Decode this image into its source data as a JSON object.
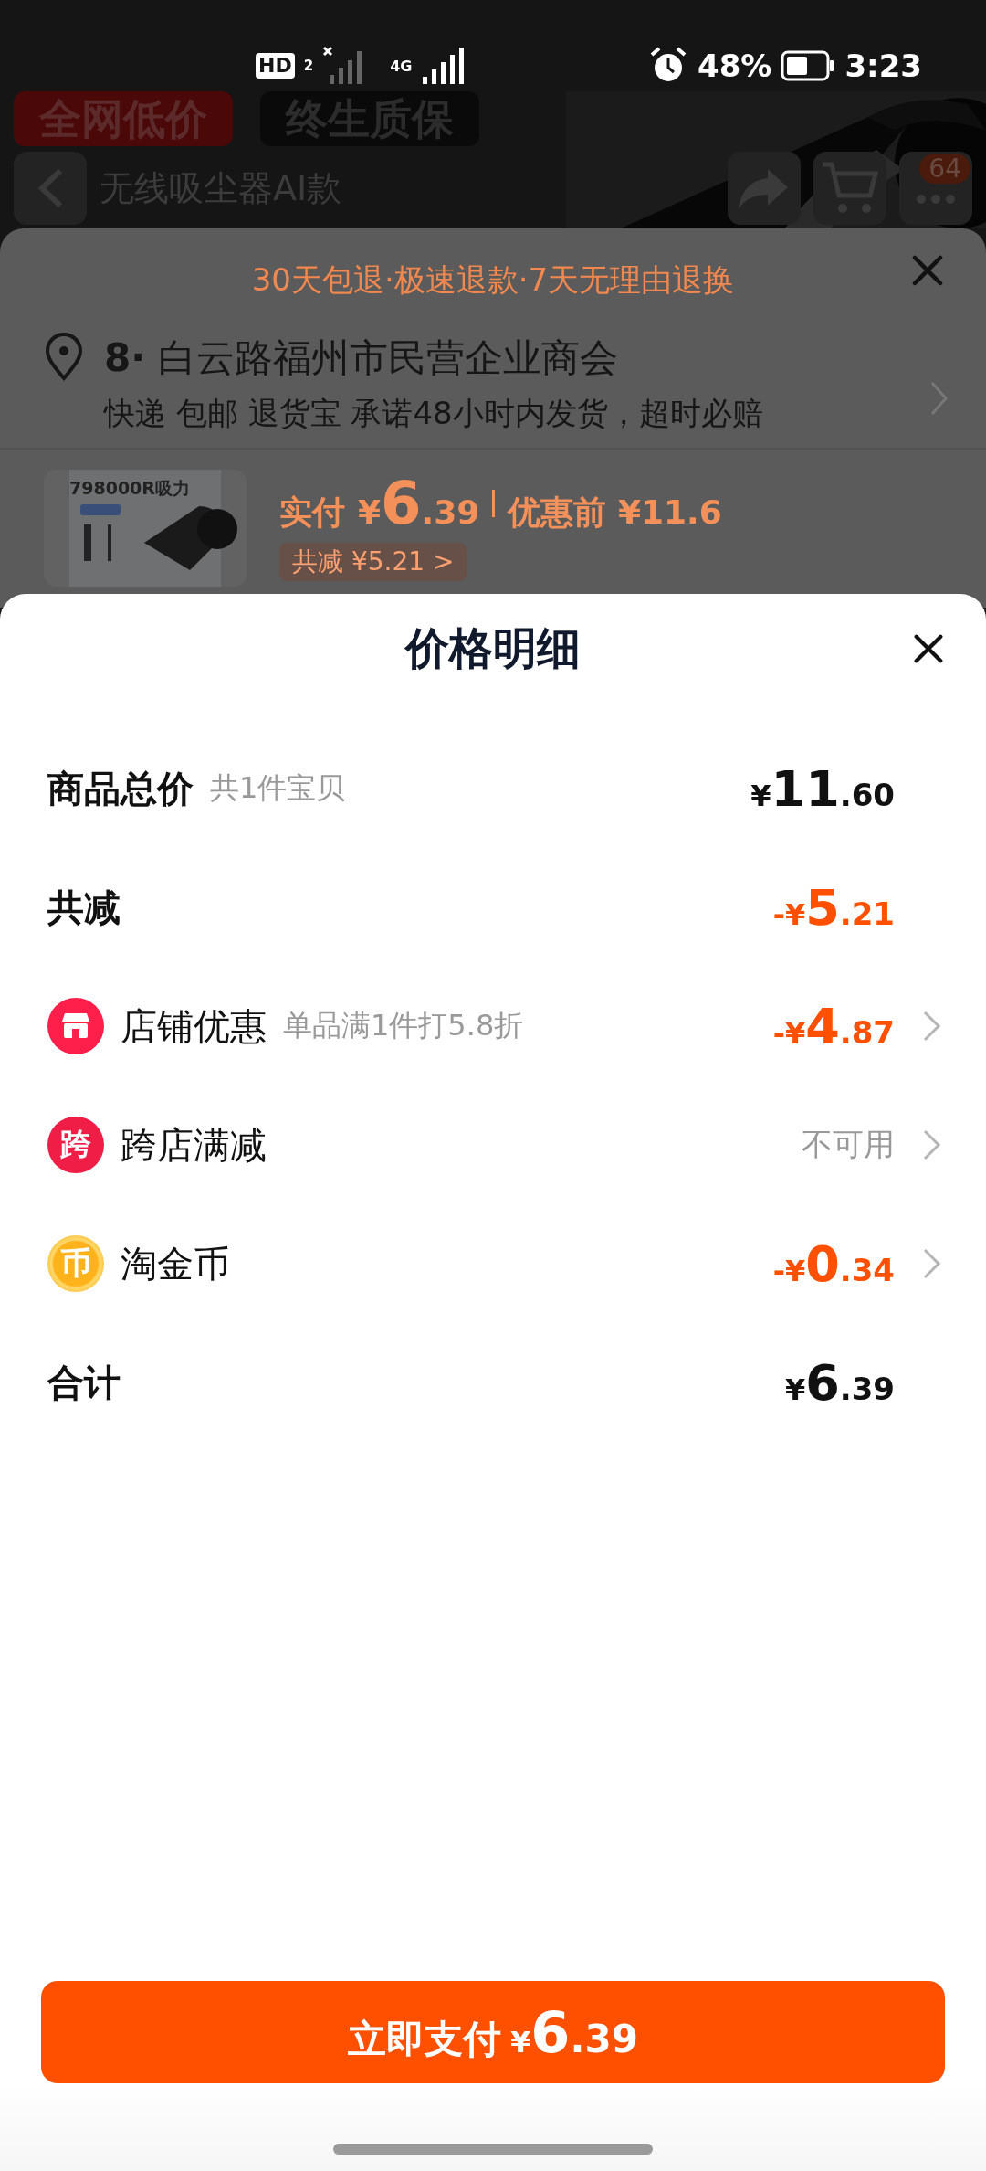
{
  "status_bar": {
    "hd": "HD",
    "sim": "2",
    "network": "4G",
    "battery": "48%",
    "time": "3:23"
  },
  "product_page": {
    "badges": [
      "全网低价",
      "终生质保"
    ],
    "title": "无线吸尘器AI款",
    "cart_count": "64"
  },
  "order_sheet": {
    "notice": "30天包退·极速退款·7天无理由退换",
    "address": "**8·** 白云路福州市民营企业商会",
    "services": "快递 包邮 退货宝 承诺48小时内发货，超时必赔",
    "product_image_label": "798000R吸力",
    "pay_label": "实付",
    "pay_currency": "¥",
    "pay_main": "6",
    "pay_fraction": ".39",
    "before_label": "优惠前 ¥11.6",
    "saved_tag": "共减 ¥5.21 >"
  },
  "price_sheet": {
    "title": "价格明细",
    "rows": [
      {
        "kind": "summary",
        "label": "商品总价",
        "note": "共1件宝贝",
        "value": {
          "kind": "amount",
          "currency": "¥",
          "main": "11",
          "fraction": ".60"
        },
        "highlight": false,
        "arrow": false
      },
      {
        "kind": "summary",
        "label": "共减",
        "value": {
          "kind": "amount",
          "sign": "-",
          "currency": "¥",
          "main": "5",
          "fraction": ".21"
        },
        "highlight": true,
        "arrow": false
      },
      {
        "kind": "store",
        "label": "店铺优惠",
        "note": "单品满1件打5.8折",
        "value": {
          "kind": "amount",
          "sign": "-",
          "currency": "¥",
          "main": "4",
          "fraction": ".87"
        },
        "highlight": true,
        "arrow": true
      },
      {
        "kind": "crossstore",
        "icon_text": "跨",
        "label": "跨店满减",
        "value": {
          "kind": "text",
          "text": "不可用"
        },
        "highlight": false,
        "arrow": true
      },
      {
        "kind": "coin",
        "icon_text": "币",
        "label": "淘金币",
        "value": {
          "kind": "amount",
          "sign": "-",
          "currency": "¥",
          "main": "0",
          "fraction": ".34"
        },
        "highlight": true,
        "arrow": true
      },
      {
        "kind": "summary",
        "label": "合计",
        "value": {
          "kind": "amount",
          "currency": "¥",
          "main": "6",
          "fraction": ".39"
        },
        "highlight": false,
        "arrow": false
      }
    ],
    "pay_button": {
      "label": "立即支付",
      "currency": "¥",
      "main": "6",
      "fraction": ".39"
    }
  }
}
